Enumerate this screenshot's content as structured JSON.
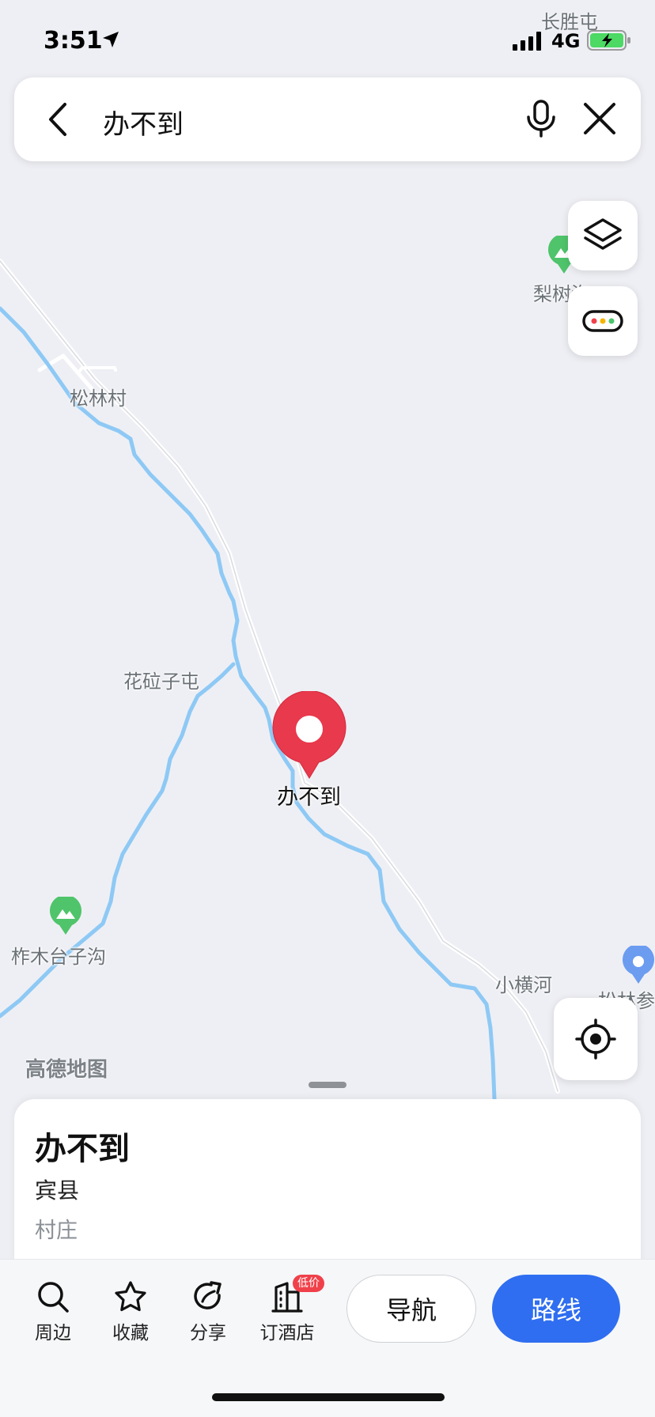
{
  "status_bar": {
    "time": "3:51",
    "network": "4G",
    "nearby_place": "长胜屯"
  },
  "search": {
    "query": "办不到",
    "back_icon": "chevron-left-icon",
    "mic_icon": "microphone-icon",
    "clear_icon": "close-icon"
  },
  "map": {
    "labels": {
      "songlin_village": "松林村",
      "lishugou": "梨树沟",
      "huazizi_tun": "花砬子屯",
      "zhamu_taizigou": "柞木台子沟",
      "xiaohenghe": "小横河",
      "songlin_partial": "松林参"
    },
    "watermark": "高德地图",
    "marker_label": "办不到",
    "marker_color": "#e8394d",
    "river_color": "#8ec9f5",
    "road_color": "#ffffff"
  },
  "controls": {
    "layers_icon": "layers-icon",
    "more_icon": "traffic-dots-icon",
    "locate_icon": "locate-target-icon"
  },
  "place": {
    "title": "办不到",
    "county": "宾县",
    "type": "村庄"
  },
  "actions": {
    "nearby": "周边",
    "favorite": "收藏",
    "share": "分享",
    "hotel": "订酒店",
    "hotel_badge": "低价",
    "navigate": "导航",
    "route": "路线",
    "route_color": "#2f6ef0"
  }
}
